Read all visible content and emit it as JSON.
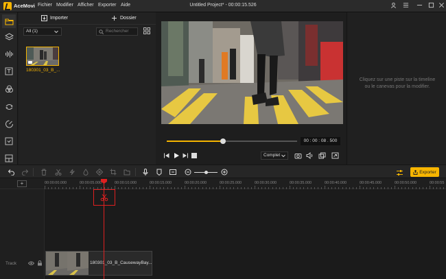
{
  "titlebar": {
    "app_name": "AceMovi",
    "menu": [
      "Fichier",
      "Modifier",
      "Afficher",
      "Exporter",
      "Aide"
    ],
    "window_title": "Untitled Project* - 00:00:15.526"
  },
  "media": {
    "import_label": "Importer",
    "folder_label": "Dossier",
    "filter_value": "All (1)",
    "search_placeholder": "Rechercher",
    "clip_name": "180301_03_B_..."
  },
  "player": {
    "timecode": "00 : 00 : 08 . 500",
    "progress": 0.43,
    "quality_value": "Complet"
  },
  "canvas_hint": "Cliquez sur une piste sur la timeline ou le canevas pour la modifier.",
  "toolbar": {
    "export_label": "Exporter",
    "accent": "#f7b500"
  },
  "timeline": {
    "ticks": [
      "00:00:00.000",
      "00:00:05.000",
      "00:00:10.000",
      "00:00:15.000",
      "00:00:20.000",
      "00:00:25.000",
      "00:00:30.000",
      "00:00:35.000",
      "00:00:40.000",
      "00:00:45.000",
      "00:00:50.000",
      "00:00:55"
    ],
    "track_label": "Track",
    "clip_label": "180301_03_B_CausewayBay...",
    "playhead_color": "#e02020"
  }
}
